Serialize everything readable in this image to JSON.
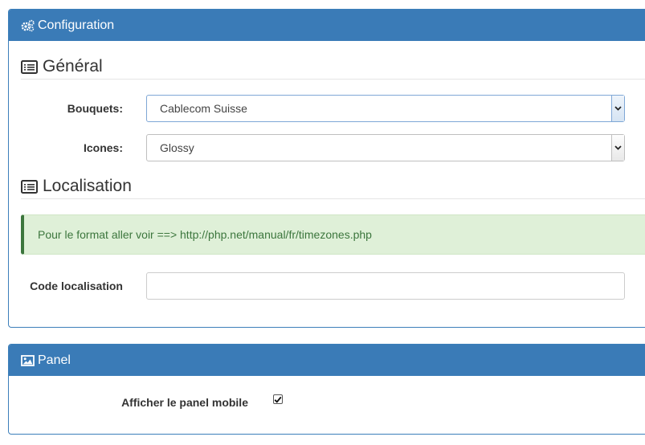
{
  "configuration": {
    "title": "Configuration",
    "icon": "gears-icon",
    "general": {
      "legend": "Général",
      "icon": "list-alt-icon",
      "bouquets": {
        "label": "Bouquets:",
        "value": "Cablecom Suisse"
      },
      "icones": {
        "label": "Icones:",
        "value": "Glossy"
      }
    },
    "localisation": {
      "legend": "Localisation",
      "icon": "list-alt-icon",
      "alert": "Pour le format aller voir ==> http://php.net/manual/fr/timezones.php",
      "code": {
        "label": "Code localisation",
        "value": "",
        "placeholder": ""
      }
    }
  },
  "panel": {
    "title": "Panel",
    "icon": "picture-icon",
    "mobile": {
      "label": "Afficher le panel mobile",
      "checked": true
    }
  },
  "colors": {
    "heading": "#3a7bb7",
    "alert_bg": "#dff0d8",
    "alert_text": "#3c763d"
  }
}
